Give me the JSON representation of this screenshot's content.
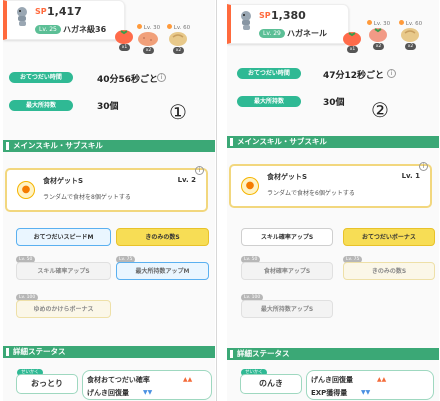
{
  "left": {
    "sp_label": "SP",
    "sp_value": "1,417",
    "level": "Lv. 25",
    "name": "ハガネ級36",
    "ingredients": [
      {
        "level": "",
        "count": "x1",
        "color": "#ff7a4a"
      },
      {
        "level": "Lv. 30",
        "count": "x2",
        "color": "#f1a07a"
      },
      {
        "level": "Lv. 60",
        "count": "x2",
        "color": "#e8c98a"
      }
    ],
    "help_label": "おてつだい時間",
    "help_value": "40分56秒ごと",
    "carry_label": "最大所持数",
    "carry_value": "30個",
    "marker": "①",
    "section_skills": "メインスキル・サブスキル",
    "skill_name": "食材ゲットS",
    "skill_level": "Lv. 2",
    "skill_desc": "ランダムで食材を8個ゲットする",
    "subs": [
      {
        "tag": "",
        "label": "おてつだいスピードM"
      },
      {
        "tag": "",
        "label": "きのみの数S"
      },
      {
        "tag": "Lv. 50",
        "label": "スキル確率アップS"
      },
      {
        "tag": "Lv. 75",
        "label": "最大所持数アップM"
      },
      {
        "tag": "Lv. 100",
        "label": "ゆめのかけらボーナス"
      }
    ],
    "section_status": "詳細ステータス",
    "nature_tag": "せいかく",
    "nature": "おっとり",
    "effects": [
      {
        "label": "食材おてつだい確率",
        "arrow": "▲▲"
      },
      {
        "label": "げんき回復量",
        "arrow": "▼▼"
      }
    ]
  },
  "right": {
    "sp_label": "SP",
    "sp_value": "1,380",
    "level": "Lv. 29",
    "name": "ハガネール",
    "ingredients": [
      {
        "level": "",
        "count": "x1",
        "color": "#ff7a4a"
      },
      {
        "level": "Lv. 30",
        "count": "x2",
        "color": "#f1a07a"
      },
      {
        "level": "Lv. 60",
        "count": "x2",
        "color": "#e8c98a"
      }
    ],
    "help_label": "おてつだい時間",
    "help_value": "47分12秒ごと",
    "carry_label": "最大所持数",
    "carry_value": "30個",
    "marker": "②",
    "section_skills": "メインスキル・サブスキル",
    "skill_name": "食材ゲットS",
    "skill_level": "Lv. 1",
    "skill_desc": "ランダムで食材を6個ゲットする",
    "subs": [
      {
        "tag": "",
        "label": "スキル確率アップS"
      },
      {
        "tag": "",
        "label": "おてつだいボーナス"
      },
      {
        "tag": "Lv. 50",
        "label": "食材確率アップS"
      },
      {
        "tag": "Lv. 75",
        "label": "きのみの数S"
      },
      {
        "tag": "Lv. 100",
        "label": "最大所持数アップS"
      }
    ],
    "section_status": "詳細ステータス",
    "nature_tag": "せいかく",
    "nature": "のんき",
    "effects": [
      {
        "label": "げんき回復量",
        "arrow": "▲▲"
      },
      {
        "label": "EXP獲得量",
        "arrow": "▼▼"
      }
    ]
  },
  "colors": {
    "accent": "#ff6a3d",
    "section": "#3ba876",
    "pill": "#2fb994",
    "skill_border": "#f2d77e"
  },
  "icons": [
    "steelix-icon",
    "tomato-icon",
    "potato-icon",
    "ginger-icon",
    "info-icon",
    "apple-icon"
  ]
}
